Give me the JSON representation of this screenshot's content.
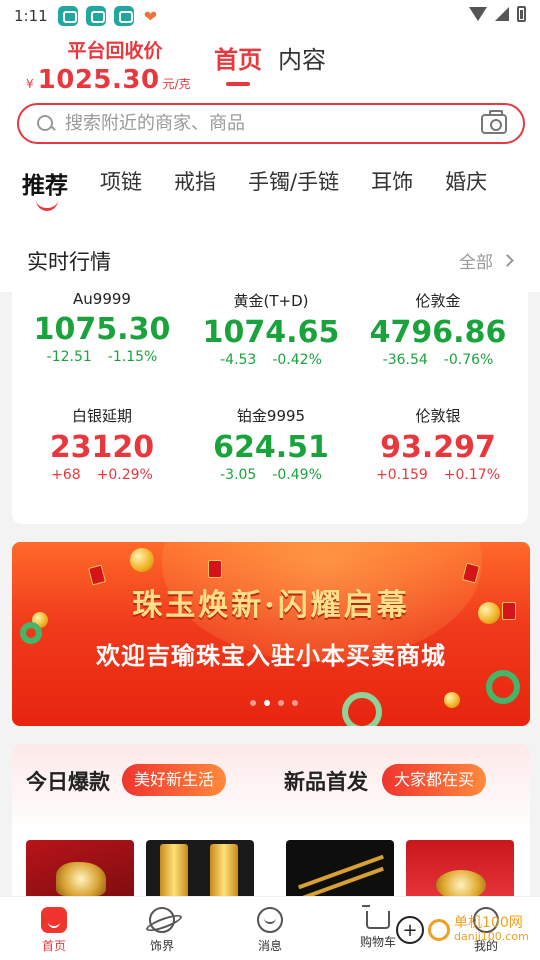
{
  "status_bar": {
    "time": "1:11"
  },
  "header": {
    "price_title": "平台回收价",
    "currency": "¥",
    "price": "1025.30",
    "unit": "元/克",
    "tabs": [
      {
        "label": "首页",
        "active": true
      },
      {
        "label": "内容",
        "active": false
      }
    ]
  },
  "search": {
    "placeholder": "搜索附近的商家、商品"
  },
  "categories": [
    "推荐",
    "项链",
    "戒指",
    "手镯/手链",
    "耳饰",
    "婚庆"
  ],
  "market": {
    "title": "实时行情",
    "all_label": "全部",
    "quotes": [
      {
        "name": "Au9999",
        "price": "1075.30",
        "change": "-12.51",
        "pct": "-1.15%",
        "dir": "down"
      },
      {
        "name": "黄金(T+D)",
        "price": "1074.65",
        "change": "-4.53",
        "pct": "-0.42%",
        "dir": "down"
      },
      {
        "name": "伦敦金",
        "price": "4796.86",
        "change": "-36.54",
        "pct": "-0.76%",
        "dir": "down"
      },
      {
        "name": "白银延期",
        "price": "23120",
        "change": "+68",
        "pct": "+0.29%",
        "dir": "up"
      },
      {
        "name": "铂金9995",
        "price": "624.51",
        "change": "-3.05",
        "pct": "-0.49%",
        "dir": "down"
      },
      {
        "name": "伦敦银",
        "price": "93.297",
        "change": "+0.159",
        "pct": "+0.17%",
        "dir": "up"
      }
    ]
  },
  "banner": {
    "title": "珠玉焕新·闪耀启幕",
    "subtitle": "欢迎吉瑜珠宝入驻小本买卖商城",
    "page_count": 4,
    "active_page": 1
  },
  "sections": {
    "today_title": "今日爆款",
    "today_tag": "美好新生活",
    "new_title": "新品首发",
    "new_tag": "大家都在买"
  },
  "bottom_nav": [
    {
      "label": "首页",
      "icon": "home-icon",
      "active": true
    },
    {
      "label": "饰界",
      "icon": "planet-icon",
      "active": false
    },
    {
      "label": "消息",
      "icon": "message-icon",
      "active": false
    },
    {
      "label": "购物车",
      "icon": "cart-icon",
      "active": false
    },
    {
      "label": "我的",
      "icon": "user-icon",
      "active": false
    }
  ],
  "watermark": {
    "line1": "单机100网",
    "line2": "danji100.com"
  },
  "colors": {
    "accent": "#e8383d",
    "up": "#e8383d",
    "down": "#1aa33c"
  }
}
